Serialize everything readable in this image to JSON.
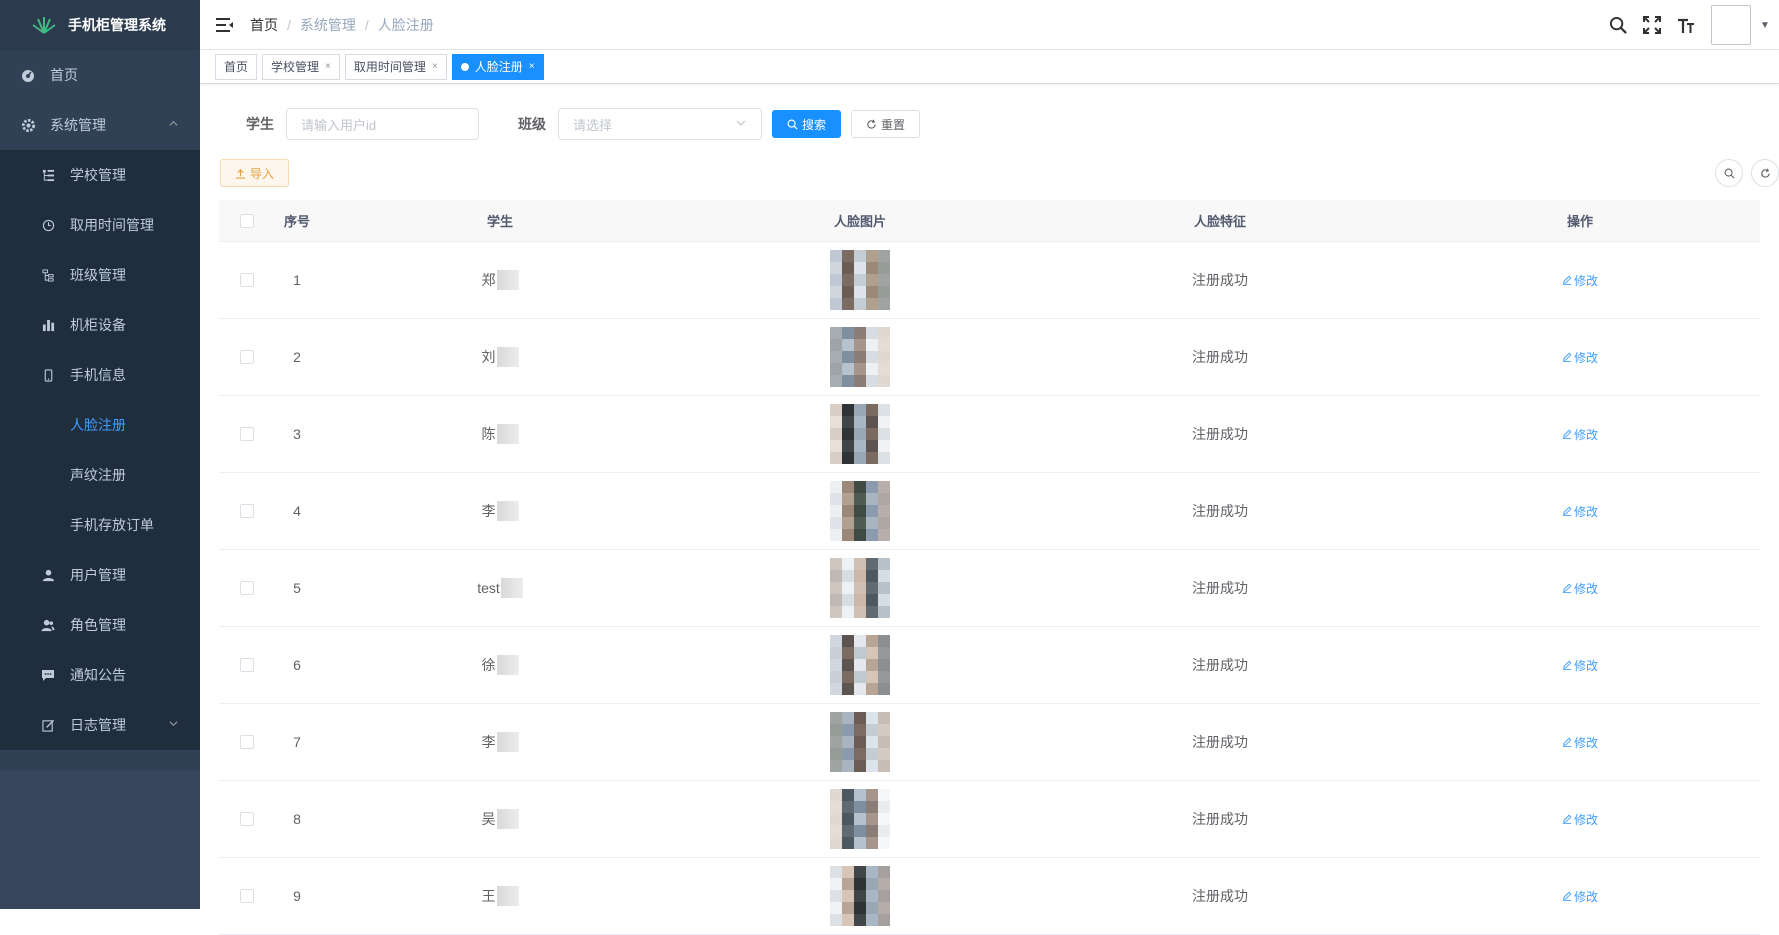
{
  "app": {
    "title": "手机柜管理系统"
  },
  "sidebar": {
    "items": [
      {
        "label": "首页",
        "icon": "dashboard-icon"
      },
      {
        "label": "系统管理",
        "icon": "gear-icon",
        "expanded": true
      }
    ],
    "submenu": [
      {
        "label": "学校管理",
        "icon": "tree-table-icon"
      },
      {
        "label": "取用时间管理",
        "icon": "clock-icon"
      },
      {
        "label": "班级管理",
        "icon": "tree-icon"
      },
      {
        "label": "机柜设备",
        "icon": "bar-chart-icon"
      },
      {
        "label": "手机信息",
        "icon": "phone-icon"
      },
      {
        "label": "人脸注册",
        "active": true
      },
      {
        "label": "声纹注册"
      },
      {
        "label": "手机存放订单"
      },
      {
        "label": "用户管理",
        "icon": "user-icon"
      },
      {
        "label": "角色管理",
        "icon": "peoples-icon"
      },
      {
        "label": "通知公告",
        "icon": "message-icon"
      },
      {
        "label": "日志管理",
        "icon": "log-icon"
      }
    ],
    "active_color": "#409eff"
  },
  "breadcrumb": [
    "首页",
    "系统管理",
    "人脸注册"
  ],
  "tags": [
    {
      "label": "首页",
      "closable": false
    },
    {
      "label": "学校管理",
      "closable": true
    },
    {
      "label": "取用时间管理",
      "closable": true
    },
    {
      "label": "人脸注册",
      "closable": true,
      "active": true
    }
  ],
  "search": {
    "student_label": "学生",
    "student_placeholder": "请输入用户id",
    "class_label": "班级",
    "class_placeholder": "请选择",
    "search_button": "搜索",
    "reset_button": "重置"
  },
  "toolbar": {
    "import_button": "导入"
  },
  "table": {
    "columns": [
      "序号",
      "学生",
      "人脸图片",
      "人脸特征",
      "操作"
    ],
    "rows": [
      {
        "index": "1",
        "student": "郑",
        "feature": "注册成功",
        "action": "修改"
      },
      {
        "index": "2",
        "student": "刘",
        "feature": "注册成功",
        "action": "修改"
      },
      {
        "index": "3",
        "student": "陈",
        "feature": "注册成功",
        "action": "修改"
      },
      {
        "index": "4",
        "student": "李",
        "feature": "注册成功",
        "action": "修改"
      },
      {
        "index": "5",
        "student": "test",
        "feature": "注册成功",
        "action": "修改"
      },
      {
        "index": "6",
        "student": "徐",
        "feature": "注册成功",
        "action": "修改"
      },
      {
        "index": "7",
        "student": "李",
        "feature": "注册成功",
        "action": "修改"
      },
      {
        "index": "8",
        "student": "吴",
        "feature": "注册成功",
        "action": "修改"
      },
      {
        "index": "9",
        "student": "王",
        "feature": "注册成功",
        "action": "修改"
      }
    ]
  },
  "colors": {
    "primary": "#1890ff",
    "sidebar_bg": "#304156",
    "warning": "#e6a23c"
  }
}
